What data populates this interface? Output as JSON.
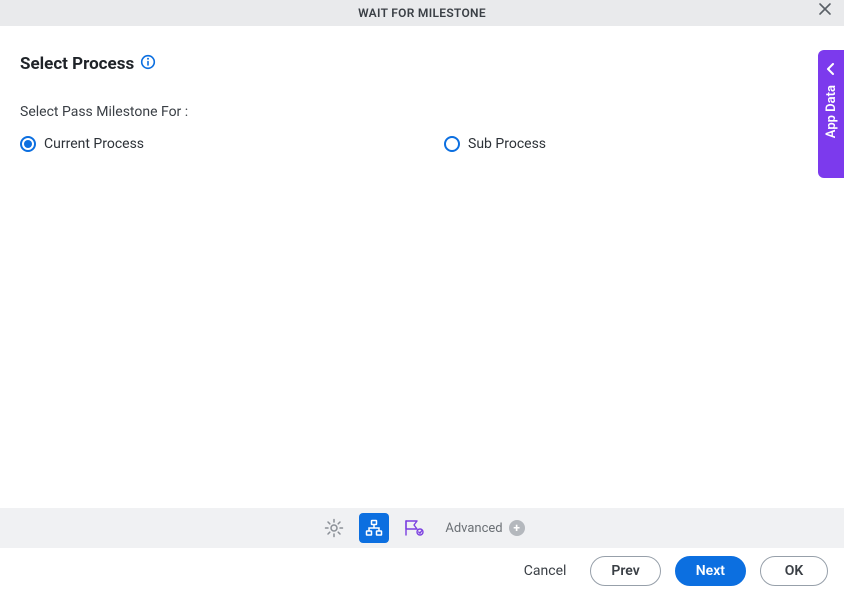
{
  "header": {
    "title": "WAIT FOR MILESTONE"
  },
  "section": {
    "title": "Select Process"
  },
  "prompt": "Select Pass Milestone For :",
  "radios": {
    "current": {
      "label": "Current Process",
      "selected": true
    },
    "sub": {
      "label": "Sub Process",
      "selected": false
    }
  },
  "side_panel": {
    "label": "App Data"
  },
  "toolbar": {
    "advanced_label": "Advanced"
  },
  "footer": {
    "cancel": "Cancel",
    "prev": "Prev",
    "next": "Next",
    "ok": "OK"
  },
  "colors": {
    "accent_blue": "#0c6fe0",
    "accent_purple": "#7c3aed"
  }
}
